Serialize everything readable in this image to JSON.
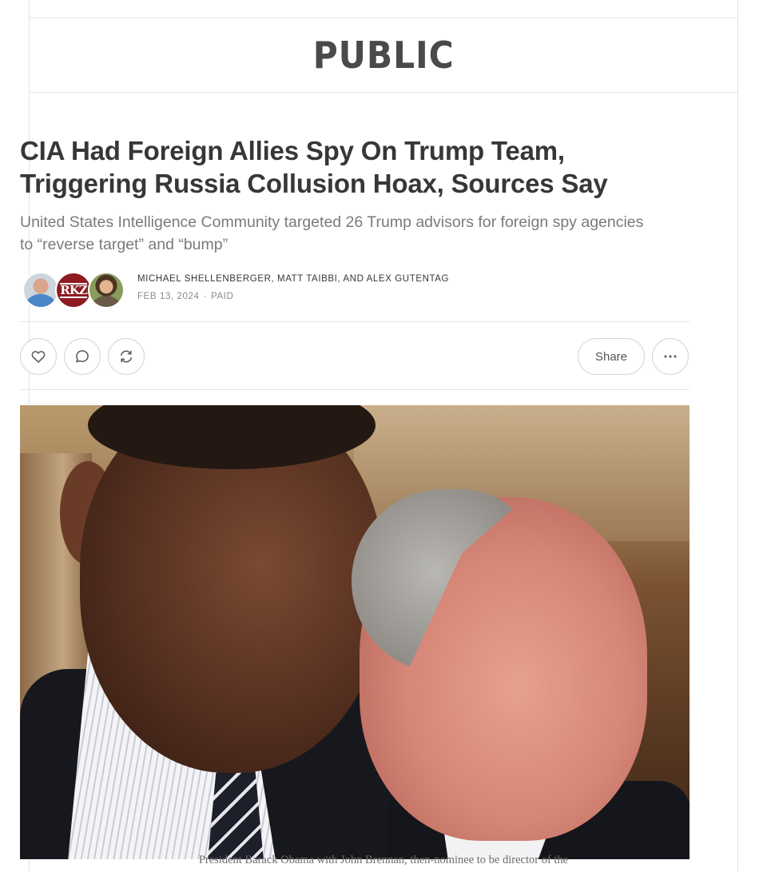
{
  "publication": {
    "name": "PUBLIC"
  },
  "post": {
    "title_line1": "CIA Had Foreign Allies Spy On Trump Team,",
    "title_line2": "Triggering Russia Collusion Hoax, Sources Say",
    "subtitle": "United States Intelligence Community targeted 26 Trump advisors for foreign spy agencies to “reverse target” and “bump”",
    "authors": "MICHAEL SHELLENBERGER, MATT TAIBBI, AND ALEX GUTENTAG",
    "date": "FEB 13, 2024",
    "access": "PAID",
    "avatar2_text": "RKZ"
  },
  "actions": {
    "share_label": "Share",
    "like_icon": "heart-icon",
    "comment_icon": "comment-icon",
    "restack_icon": "restack-icon",
    "more_icon": "more-icon"
  },
  "image": {
    "caption": "President Barack Obama with John Brennan, then-nominee to be director of the"
  },
  "colors": {
    "text": "#363737",
    "muted": "#7a7a7a",
    "border": "#e3e3e3"
  }
}
